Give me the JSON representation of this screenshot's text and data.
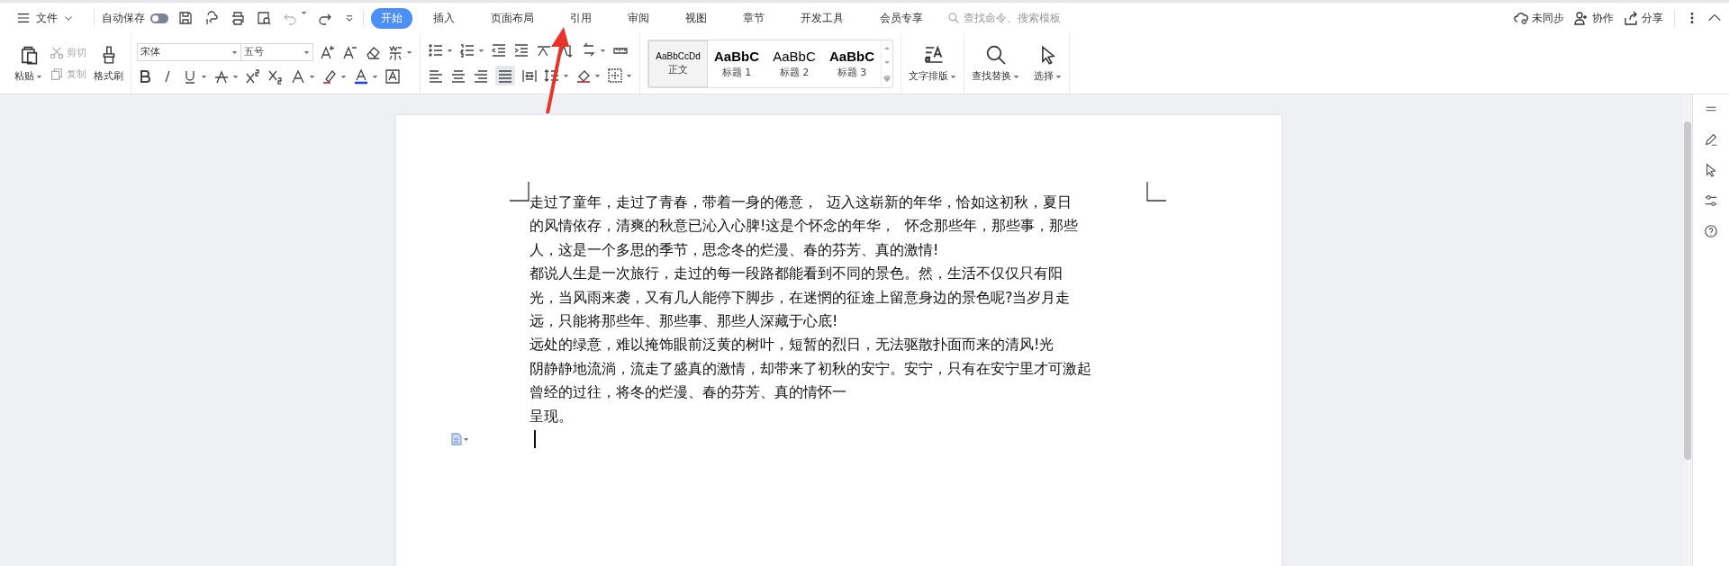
{
  "menu": {
    "label": "文件"
  },
  "autosave": {
    "label": "自动保存",
    "on": false
  },
  "tabs": [
    {
      "label": "开始",
      "selected": true
    },
    {
      "label": "插入",
      "selected": false
    },
    {
      "label": "页面布局",
      "selected": false
    },
    {
      "label": "引用",
      "selected": false
    },
    {
      "label": "审阅",
      "selected": false
    },
    {
      "label": "视图",
      "selected": false
    },
    {
      "label": "章节",
      "selected": false
    },
    {
      "label": "开发工具",
      "selected": false
    },
    {
      "label": "会员专享",
      "selected": false
    }
  ],
  "search": {
    "placeholder": "查找命令、搜索模板"
  },
  "account_actions": [
    {
      "kind": "sync",
      "label": "未同步"
    },
    {
      "kind": "collab",
      "label": "协作"
    },
    {
      "kind": "share",
      "label": "分享"
    }
  ],
  "ribbon": {
    "clipboard": {
      "paste": "粘贴",
      "cut": {
        "label": "剪切",
        "disabled": true
      },
      "copy": {
        "label": "复制",
        "disabled": true
      },
      "format_painter": "格式刷"
    },
    "font": {
      "name": "宋体",
      "size": "五号"
    },
    "styles": [
      {
        "kind": "body",
        "sample": "AaBbCcDd",
        "label": "正文",
        "selected": true
      },
      {
        "kind": "heading",
        "sample": "AaBbC",
        "label": "标题 1",
        "selected": false
      },
      {
        "kind": "subheading",
        "sample": "AaBbC",
        "label": "标题 2",
        "selected": false
      },
      {
        "kind": "heading",
        "sample": "AaBbC",
        "label": "标题 3",
        "selected": false
      }
    ],
    "text_layout": "文字排版",
    "find_replace": "查找替换",
    "select": "选择"
  },
  "document": {
    "lines": [
      "走过了童年，走过了青春，带着一身的倦意，  迈入这崭新的年华，恰如这初秋，夏日",
      "的风情依存，清爽的秋意已沁入心脾!这是个怀念的年华，  怀念那些年，那些事，那些",
      "人，这是一个多思的季节，思念冬的烂漫、春的芬芳、真的激情!",
      "都说人生是一次旅行，走过的每一段路都能看到不同的景色。然，生活不仅仅只有阳",
      "光，当风雨来袭，又有几人能停下脚步，在迷惘的征途上留意身边的景色呢?当岁月走",
      "远，只能将那些年、那些事、那些人深藏于心底!",
      "远处的绿意，难以掩饰眼前泛黄的树叶，短暂的烈日，无法驱散扑面而来的清风!光",
      "阴静静地流淌，流走了盛真的激情，却带来了初秋的安宁。安宁，只有在安宁里才可激起",
      "曾经的过往，将冬的烂漫、春的芬芳、真的情怀一",
      "呈现。"
    ]
  }
}
